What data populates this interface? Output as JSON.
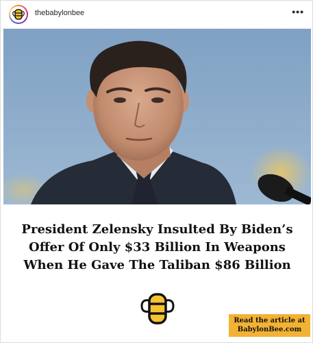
{
  "post": {
    "username": "thebabylonbee",
    "more_label": "•••",
    "avatar_icon": "babylon-bee-logo-icon",
    "headline_lines": [
      "President Zelensky Insulted By Biden’s",
      "Offer Of Only $33 Billion In Weapons",
      "When He Gave The Taliban $86 Billion"
    ],
    "cta": {
      "line1": "Read the article at",
      "line2": "BabylonBee.com"
    }
  },
  "colors": {
    "sky": "#8aa9c8",
    "cta": "#f2b233",
    "bee_yellow": "#f5c230"
  }
}
